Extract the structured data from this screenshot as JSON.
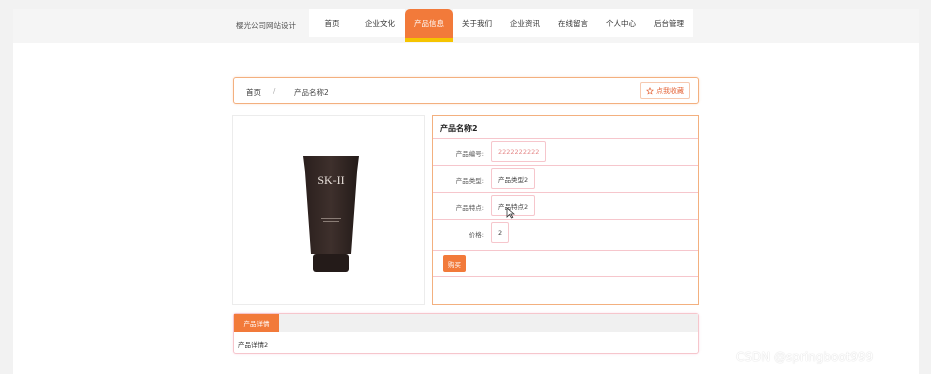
{
  "header": {
    "site_title": "樱光公司网站设计",
    "nav": [
      {
        "label": "首页"
      },
      {
        "label": "企业文化"
      },
      {
        "label": "产品信息"
      },
      {
        "label": "关于我们"
      },
      {
        "label": "企业资讯"
      },
      {
        "label": "在线留言"
      },
      {
        "label": "个人中心"
      },
      {
        "label": "后台管理"
      }
    ],
    "active_nav": "产品信息"
  },
  "breadcrumb": {
    "home": "首页",
    "separator": "/",
    "current": "产品名称2",
    "favorite_label": "点我收藏"
  },
  "product": {
    "image_label": "SK-II",
    "name": "产品名称2",
    "fields": [
      {
        "label": "产品编号:",
        "value": "2222222222"
      },
      {
        "label": "产品类型:",
        "value": "产品类型2"
      },
      {
        "label": "产品特点:",
        "value": "产品特点2"
      },
      {
        "label": "价格:",
        "value": "2"
      }
    ],
    "buy_label": "购买"
  },
  "details": {
    "tab_label": "产品详情",
    "text": "产品详情2"
  },
  "watermark": "CSDN @springboot999",
  "colors": {
    "accent": "#f27a3a",
    "accent_underline": "#f5c400",
    "border_orange": "#f3b07f",
    "border_pink": "#f6c6cc"
  }
}
